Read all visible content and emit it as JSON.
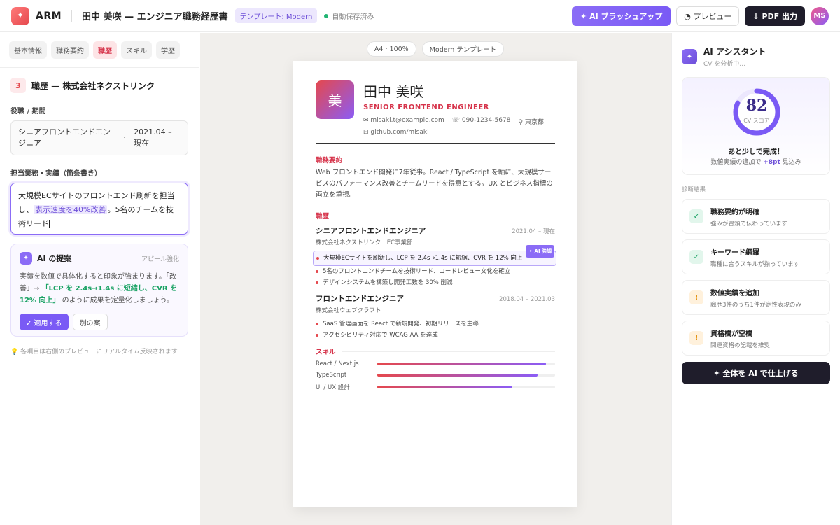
{
  "app": {
    "logo_icon": "✦",
    "logo_text": "ARM",
    "doc_title": "田中 美咲 — エンジニア職務経歴書",
    "template_badge": "テンプレート: Modern",
    "save_status": "自動保存済み"
  },
  "toolbar": {
    "ai_brushup": "✦ AI ブラッシュアップ",
    "preview": "◔ プレビュー",
    "pdf": "↓ PDF 出力",
    "avatar": "MS"
  },
  "left": {
    "tabs": [
      "基本情報",
      "職務要約",
      "職歴",
      "スキル",
      "学歴"
    ],
    "active_tab": 2,
    "section_num": "3",
    "section_title": "職歴 — 株式会社ネクストリンク",
    "role_label": "役職 / 期間",
    "role_value": "シニアフロントエンドエンジニア",
    "period_sep": "·",
    "period_value": "2021.04 – 現在",
    "duties_label": "担当業務・実績（箇条書き）",
    "duties_part1": "大規模ECサイトのフロントエンド刷新を担当し、",
    "duties_highlight": "表示速度を40%改善",
    "duties_part2": "。5名のチームを技術リード",
    "ai_card": {
      "icon": "✦",
      "title": "AI の提案",
      "tag": "アピール強化",
      "body_pre": "実績を数値で具体化すると印象が強まります。「改善」→ ",
      "body_green": "「LCP を 2.4s→1.4s に短縮し、CVR を 12% 向上」",
      "body_post": " のように成果を定量化しましょう。",
      "apply": "✓ 適用する",
      "alt": "別の案"
    },
    "hint": "💡 各項目は右側のプレビューにリアルタイム反映されます"
  },
  "center": {
    "chip_zoom": "A4 · 100%",
    "chip_template": "Modern テンプレート",
    "cv": {
      "monogram": "美",
      "name": "田中 美咲",
      "role": "SENIOR FRONTEND ENGINEER",
      "email": "✉ misaki.t@example.com",
      "phone": "☏ 090-1234-5678",
      "location": "⚲ 東京都",
      "github": "⊡ github.com/misaki",
      "summary_heading": "職務要約",
      "summary": "Web フロントエンド開発に7年従事。React / TypeScript を軸に、大規模サービスのパフォーマンス改善とチームリードを得意とする。UX とビジネス指標の両立を重視。",
      "exp_heading": "職歴",
      "jobs": [
        {
          "title": "シニアフロントエンドエンジニア",
          "period": "2021.04 – 現在",
          "company": "株式会社ネクストリンク｜EC事業部",
          "bullets": [
            "大規模ECサイトを刷新し、LCP を 2.4s→1.4s に短縮、CVR を 12% 向上",
            "5名のフロントエンドチームを技術リード、コードレビュー文化を確立",
            "デザインシステムを構築し開発工数を 30% 削減"
          ]
        },
        {
          "title": "フロントエンドエンジニア",
          "period": "2018.04 – 2021.03",
          "company": "株式会社ウェブクラフト",
          "bullets": [
            "SaaS 管理画面を React で新規開発、初期リリースを主導",
            "アクセシビリティ対応で WCAG AA を達成"
          ]
        }
      ],
      "ai_tag": "✦ AI 強調",
      "skills_heading": "スキル",
      "skills": [
        {
          "name": "React / Next.js",
          "level": 0.95
        },
        {
          "name": "TypeScript",
          "level": 0.9
        },
        {
          "name": "UI / UX 設計",
          "level": 0.76
        }
      ]
    }
  },
  "right": {
    "icon": "✦",
    "title": "AI アシスタント",
    "subtitle": "CV を分析中…",
    "score": "82",
    "score_value": 0.82,
    "score_label": "CV スコア",
    "score_message": "あと少しで完成！",
    "score_hint_pre": "数値実績の追加で ",
    "score_hint_bold": "+8pt",
    "score_hint_post": " 見込み",
    "diag_label": "診断結果",
    "diagnostics": [
      {
        "status": "ok",
        "icon": "✓",
        "title": "職務要約が明確",
        "desc": "強みが冒頭で伝わっています"
      },
      {
        "status": "ok",
        "icon": "✓",
        "title": "キーワード網羅",
        "desc": "職種に合うスキルが揃っています"
      },
      {
        "status": "warn",
        "icon": "!",
        "title": "数値実績を追加",
        "desc": "職歴3件のうち1件が定性表現のみ"
      },
      {
        "status": "warn",
        "icon": "!",
        "title": "資格欄が空欄",
        "desc": "関連資格の記載を推奨"
      }
    ],
    "finish": "✦ 全体を AI で仕上げる"
  }
}
